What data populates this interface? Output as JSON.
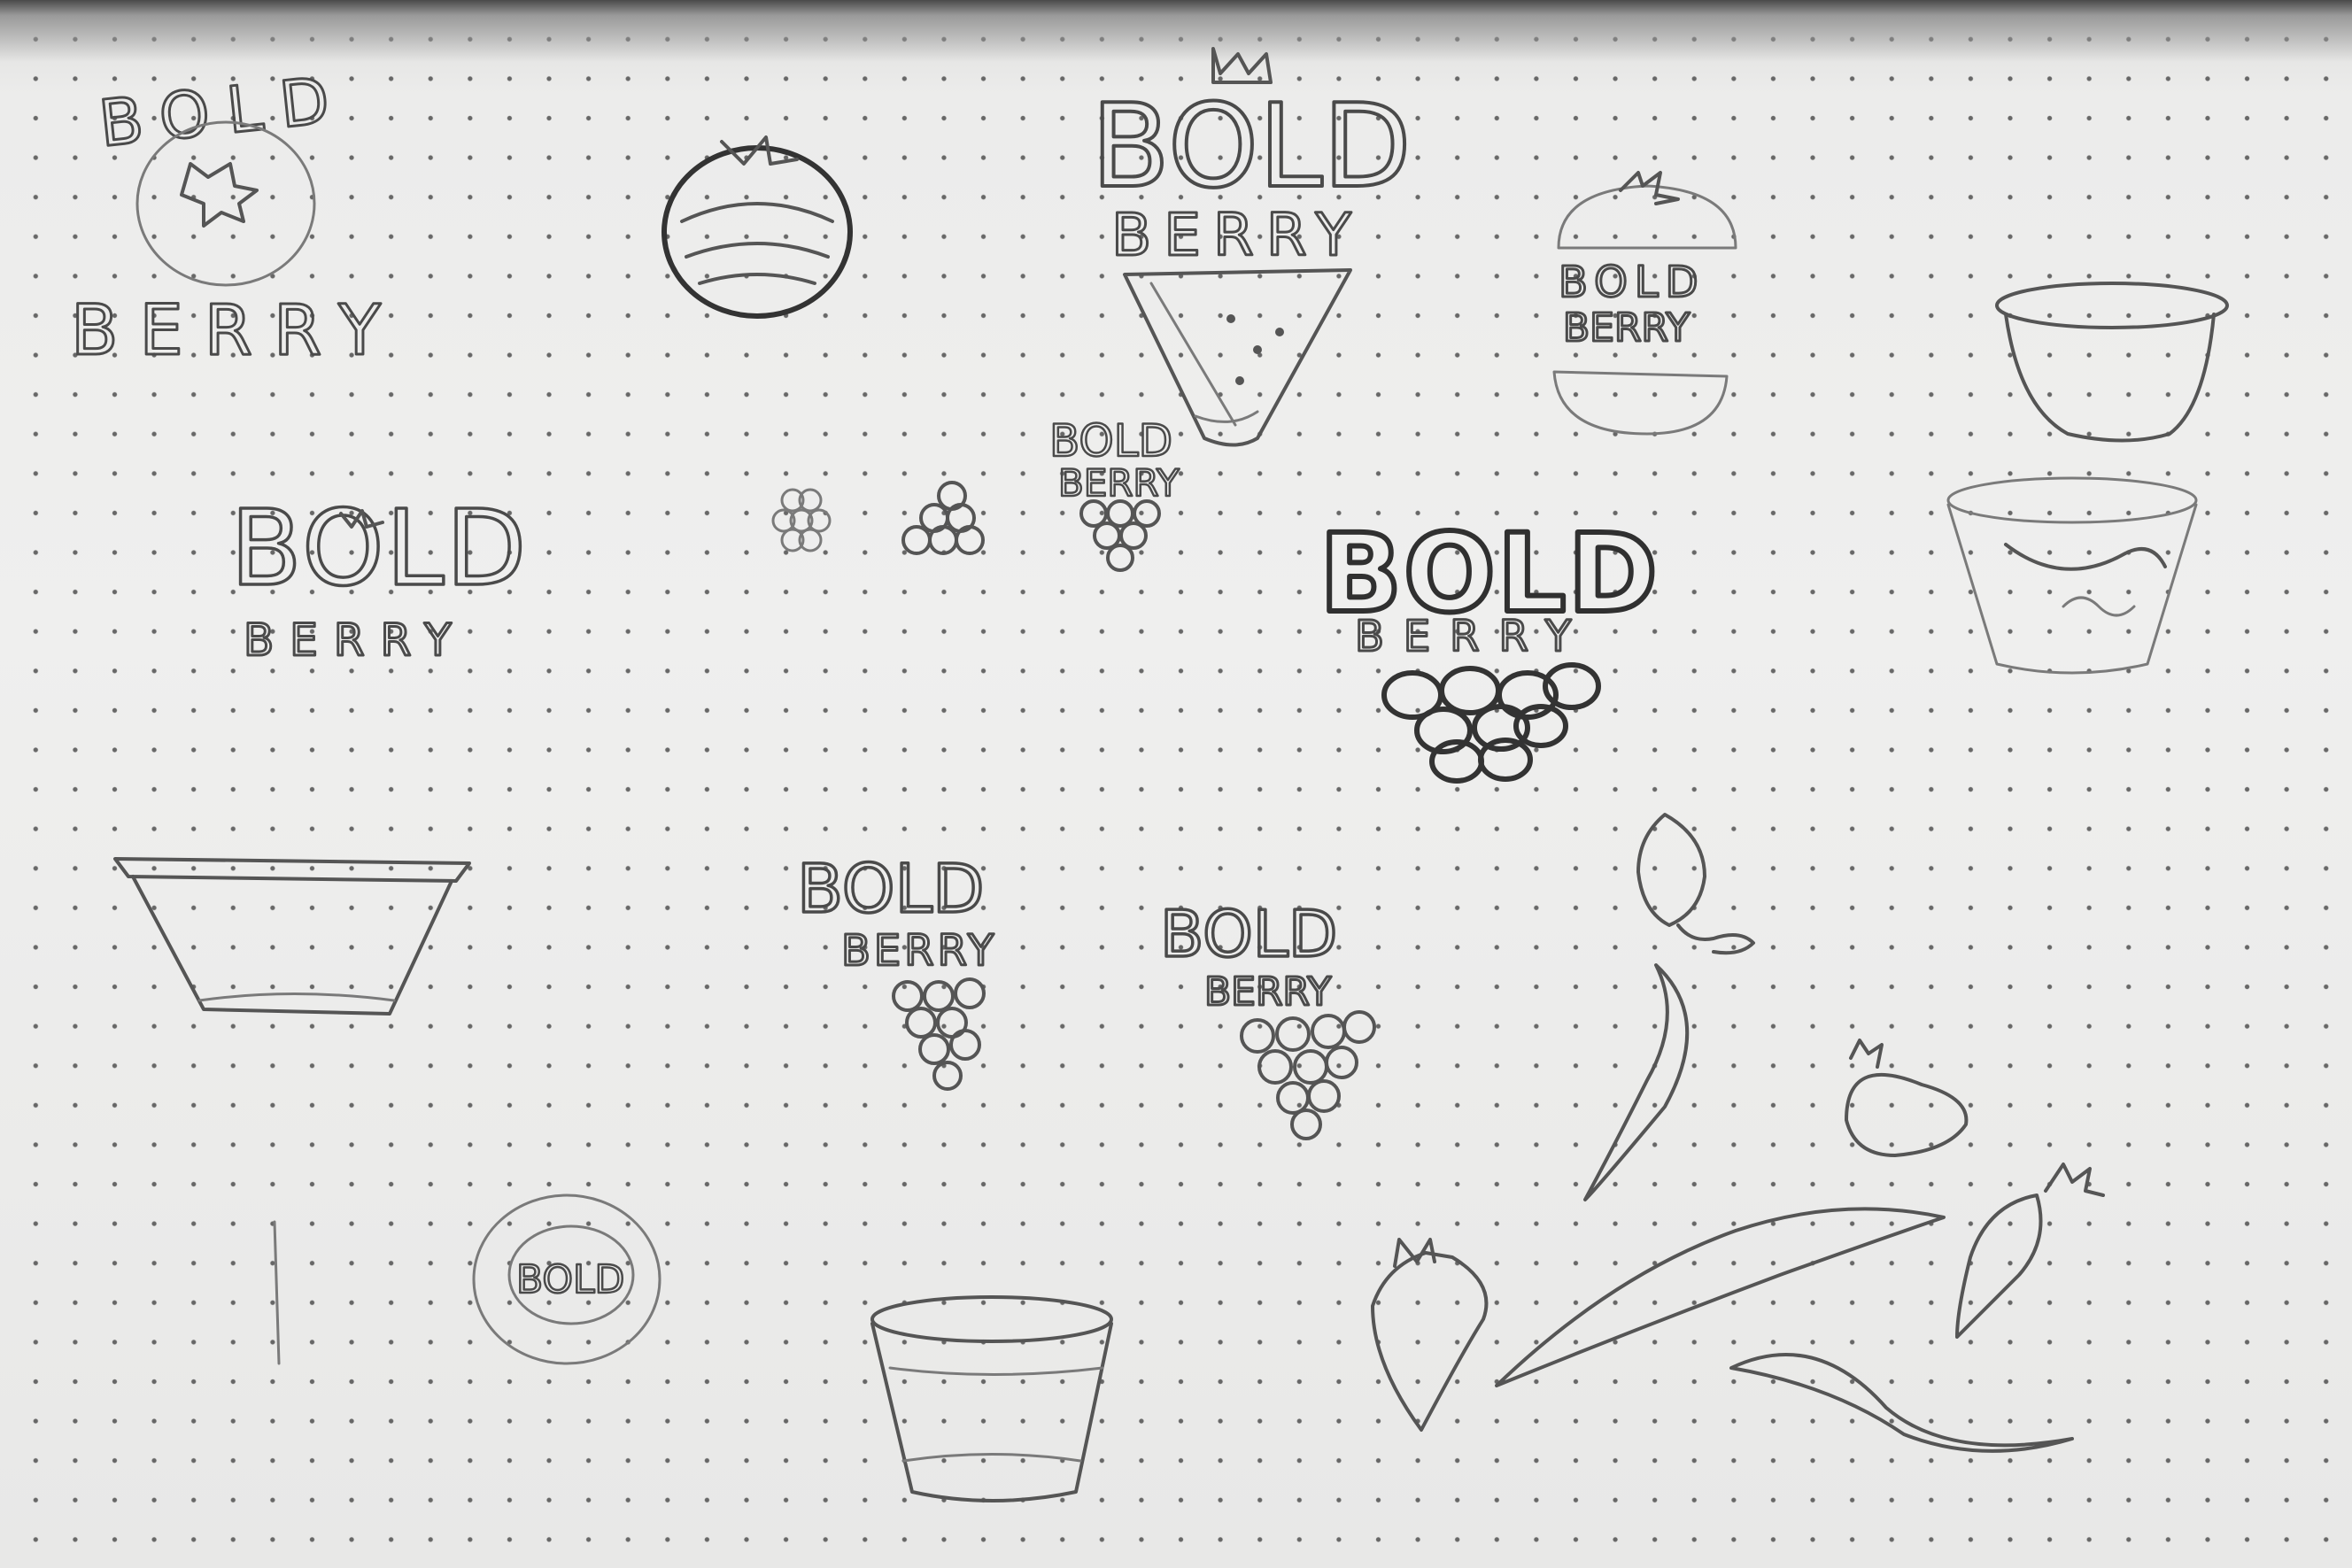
{
  "image": {
    "kind": "pencil sketch on dot-grid paper",
    "colors": {
      "paper": "#efefee",
      "graphite": "#4a4a4a",
      "dots": "#3a3a3a"
    }
  },
  "wordmark": {
    "line1": "BOLD",
    "line2": "BERRY"
  },
  "sketches": [
    {
      "name": "logo-circle-blueberry",
      "bold": "BOLD",
      "berry": "BERRY"
    },
    {
      "name": "shaded-blueberry"
    },
    {
      "name": "logo-crown-watermelon",
      "bold": "BOLD",
      "berry": "BERRY"
    },
    {
      "name": "logo-tomato-split",
      "bold": "BOLD",
      "berry": "BERRY"
    },
    {
      "name": "cup-with-lid"
    },
    {
      "name": "logo-berry-o",
      "bold": "BOLD",
      "berry": "BERRY"
    },
    {
      "name": "berry-clusters-small",
      "bold": "BOLD",
      "berry": "BERRY"
    },
    {
      "name": "logo-grape-cluster-large",
      "bold": "BOLD",
      "berry": "BERRY"
    },
    {
      "name": "tall-cup-with-label"
    },
    {
      "name": "wide-bowl"
    },
    {
      "name": "logo-grape-cluster-a",
      "bold": "BOLD",
      "berry": "BERRY"
    },
    {
      "name": "logo-grape-cluster-b",
      "bold": "BOLD",
      "berry": "BERRY"
    },
    {
      "name": "strawberry-with-swoosh"
    },
    {
      "name": "seal-circle",
      "bold": "BOLD"
    },
    {
      "name": "cup-tall-sketch"
    },
    {
      "name": "strawberry-carrot-swooshes"
    }
  ]
}
